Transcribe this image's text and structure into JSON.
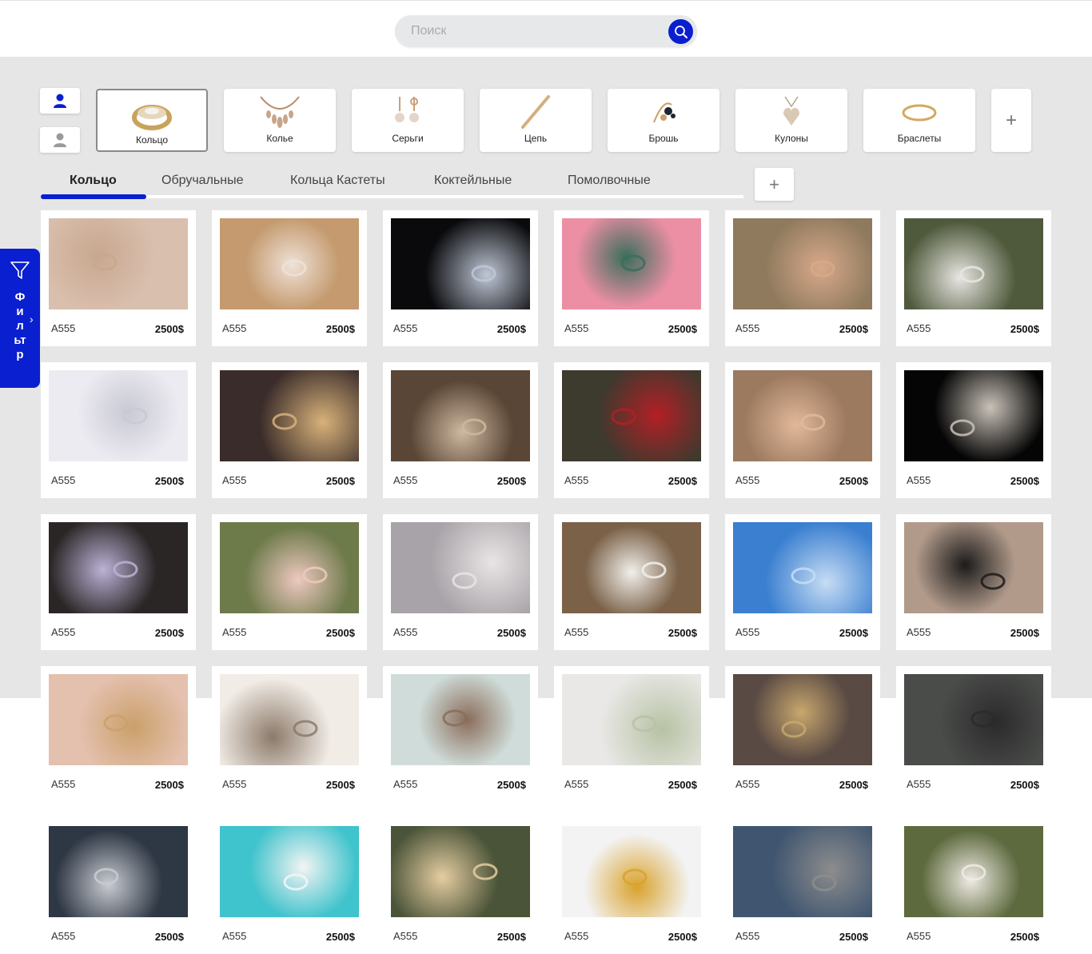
{
  "search": {
    "placeholder": "Поиск",
    "icon": "search-icon"
  },
  "accent_color": "#0a1fd0",
  "user_buttons": [
    {
      "icon": "user-icon",
      "color": "#0a1fd0"
    },
    {
      "icon": "user-icon",
      "color": "#9a9a9a"
    }
  ],
  "categories": [
    {
      "label": "Кольцо",
      "icon": "ring-icon",
      "active": true
    },
    {
      "label": "Колье",
      "icon": "necklace-icon",
      "active": false
    },
    {
      "label": "Серьги",
      "icon": "earrings-icon",
      "active": false
    },
    {
      "label": "Цепь",
      "icon": "chain-icon",
      "active": false
    },
    {
      "label": "Брошь",
      "icon": "brooch-icon",
      "active": false
    },
    {
      "label": "Кулоны",
      "icon": "pendant-icon",
      "active": false
    },
    {
      "label": "Браслеты",
      "icon": "bracelet-icon",
      "active": false
    }
  ],
  "category_add_label": "+",
  "tabs": [
    {
      "label": "Кольцо",
      "active": true
    },
    {
      "label": "Обручальные",
      "active": false
    },
    {
      "label": "Кольца Кастеты",
      "active": false
    },
    {
      "label": "Коктейльные",
      "active": false
    },
    {
      "label": "Помолвочные",
      "active": false
    }
  ],
  "tab_add_label": "+",
  "filter": {
    "label": "Фильтр",
    "icon": "filter-icon",
    "chevron": "›"
  },
  "products": [
    {
      "code": "A555",
      "price": "2500$",
      "bg": "#d9bfae",
      "accent": "#c8a78e"
    },
    {
      "code": "A555",
      "price": "2500$",
      "bg": "#c49a6e",
      "accent": "#efe2d8"
    },
    {
      "code": "A555",
      "price": "2500$",
      "bg": "#0a0a0c",
      "accent": "#bfc7d6"
    },
    {
      "code": "A555",
      "price": "2500$",
      "bg": "#ec8fa4",
      "accent": "#3a6e5c"
    },
    {
      "code": "A555",
      "price": "2500$",
      "bg": "#8f7a5e",
      "accent": "#d8a98a"
    },
    {
      "code": "A555",
      "price": "2500$",
      "bg": "#4f5a3c",
      "accent": "#e9e6e2"
    },
    {
      "code": "A555",
      "price": "2500$",
      "bg": "#ecebf2",
      "accent": "#c9c9d4"
    },
    {
      "code": "A555",
      "price": "2500$",
      "bg": "#3a2c2a",
      "accent": "#d8b27a"
    },
    {
      "code": "A555",
      "price": "2500$",
      "bg": "#5a4636",
      "accent": "#cdb9a0"
    },
    {
      "code": "A555",
      "price": "2500$",
      "bg": "#3d3a2e",
      "accent": "#b31f25"
    },
    {
      "code": "A555",
      "price": "2500$",
      "bg": "#9c7a60",
      "accent": "#e2b89a"
    },
    {
      "code": "A555",
      "price": "2500$",
      "bg": "#050505",
      "accent": "#c9c2b8"
    },
    {
      "code": "A555",
      "price": "2500$",
      "bg": "#2a2626",
      "accent": "#bcb2d6"
    },
    {
      "code": "A555",
      "price": "2500$",
      "bg": "#6d7a4a",
      "accent": "#eec9c0"
    },
    {
      "code": "A555",
      "price": "2500$",
      "bg": "#a8a3a8",
      "accent": "#e9e4e4"
    },
    {
      "code": "A555",
      "price": "2500$",
      "bg": "#7a6148",
      "accent": "#f2f0ec"
    },
    {
      "code": "A555",
      "price": "2500$",
      "bg": "#3a7fd0",
      "accent": "#c7ddf4"
    },
    {
      "code": "A555",
      "price": "2500$",
      "bg": "#b19a8a",
      "accent": "#1b1b1b"
    },
    {
      "code": "A555",
      "price": "2500$",
      "bg": "#e4c0ae",
      "accent": "#caa06a"
    },
    {
      "code": "A555",
      "price": "2500$",
      "bg": "#f1ece6",
      "accent": "#8c7a6a"
    },
    {
      "code": "A555",
      "price": "2500$",
      "bg": "#cfdcd9",
      "accent": "#8a6d5a"
    },
    {
      "code": "A555",
      "price": "2500$",
      "bg": "#e9e8e6",
      "accent": "#b7c2a4"
    },
    {
      "code": "A555",
      "price": "2500$",
      "bg": "#5a4a44",
      "accent": "#c8a86e"
    },
    {
      "code": "A555",
      "price": "2500$",
      "bg": "#4a4c4a",
      "accent": "#2a2a2a"
    },
    {
      "code": "A555",
      "price": "2500$",
      "bg": "#2e3744",
      "accent": "#c9cbd1"
    },
    {
      "code": "A555",
      "price": "2500$",
      "bg": "#3fc3cc",
      "accent": "#f4f4f4"
    },
    {
      "code": "A555",
      "price": "2500$",
      "bg": "#4a5438",
      "accent": "#e6cda2"
    },
    {
      "code": "A555",
      "price": "2500$",
      "bg": "#f3f3f3",
      "accent": "#d9a22c"
    },
    {
      "code": "A555",
      "price": "2500$",
      "bg": "#3f5570",
      "accent": "#8d8d8d"
    },
    {
      "code": "A555",
      "price": "2500$",
      "bg": "#5d6a3e",
      "accent": "#f0ebe5"
    }
  ]
}
